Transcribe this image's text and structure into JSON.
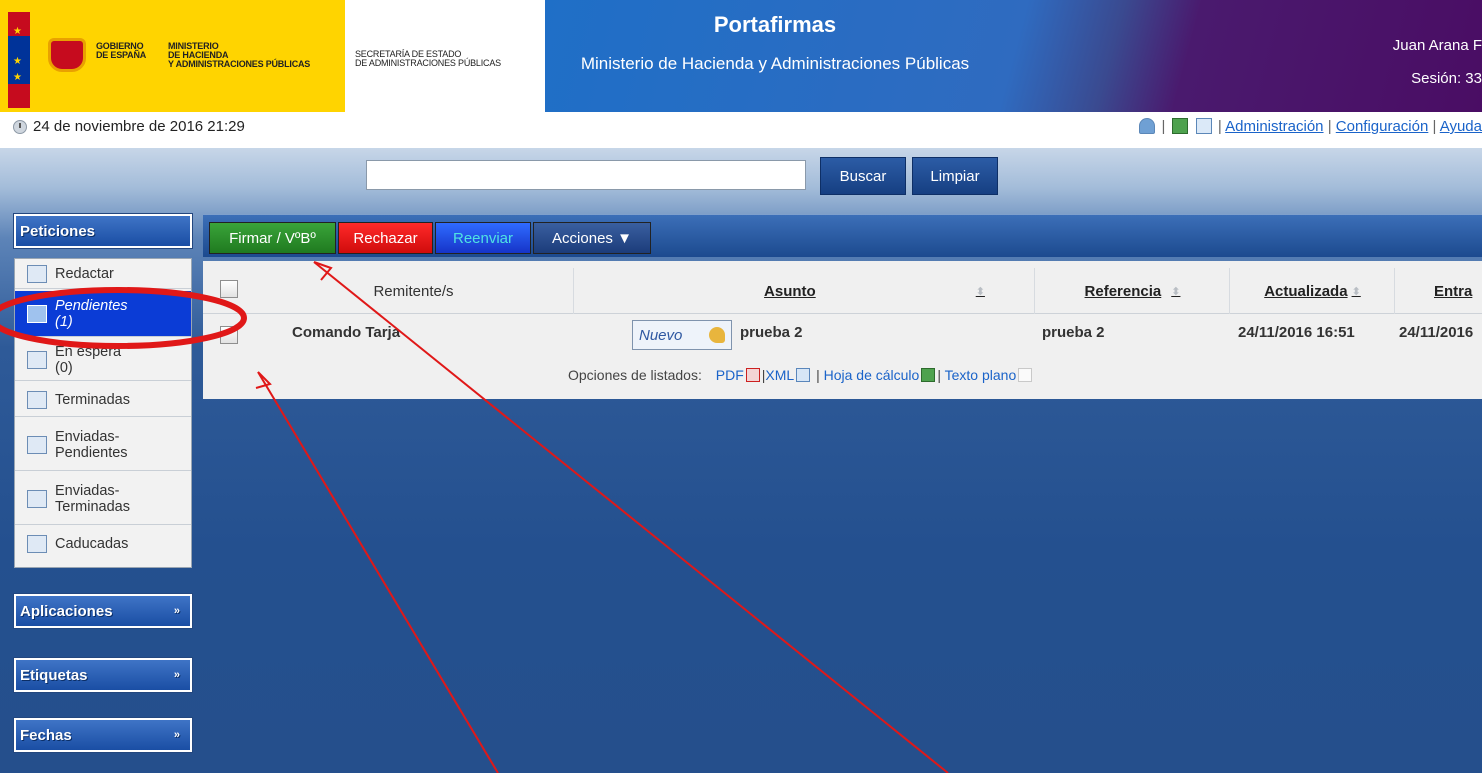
{
  "header": {
    "gov_line1": "GOBIERNO",
    "gov_line2": "DE ESPAÑA",
    "ministry_line1": "MINISTERIO",
    "ministry_line2": "DE HACIENDA",
    "ministry_line3": "Y ADMINISTRACIONES PÚBLICAS",
    "secretary_line1": "SECRETARÍA DE ESTADO",
    "secretary_line2": "DE ADMINISTRACIONES PÚBLICAS",
    "app_title": "Portafirmas",
    "ministry_title": "Ministerio de Hacienda y Administraciones Públicas",
    "user_name": "Juan Arana F",
    "session": "Sesión: 33"
  },
  "infobar": {
    "datetime": "24 de noviembre de 2016 21:29",
    "links": [
      "Administración",
      "Configuración",
      "Ayuda"
    ]
  },
  "search": {
    "value": "",
    "search_button": "Buscar",
    "clear_button": "Limpiar"
  },
  "sidebar": {
    "peticiones_title": "Peticiones",
    "items": [
      {
        "label": "Redactar",
        "icon": "compose-icon"
      },
      {
        "label": "Pendientes",
        "count": "(1)",
        "icon": "envelope-icon",
        "active": true
      },
      {
        "label": "En espera",
        "count": "(0)",
        "icon": "waiting-icon"
      },
      {
        "label": "Terminadas",
        "icon": "finished-icon"
      },
      {
        "label": "Enviadas-",
        "label2": "Pendientes",
        "icon": "sent-pending-icon"
      },
      {
        "label": "Enviadas-",
        "label2": "Terminadas",
        "icon": "sent-finished-icon"
      },
      {
        "label": "Caducadas",
        "icon": "expired-icon"
      }
    ],
    "aplicaciones": "Aplicaciones",
    "etiquetas": "Etiquetas",
    "fechas": "Fechas",
    "chevron": "»"
  },
  "toolbar": {
    "sign": "Firmar / VºBº",
    "reject": "Rechazar",
    "forward": "Reenviar",
    "actions": "Acciones ▼"
  },
  "table": {
    "columns": [
      "Remitente/s",
      "Asunto",
      "Referencia",
      "Actualizada",
      "Entra"
    ],
    "rows": [
      {
        "sender": "Comando Tarja",
        "badge": "Nuevo",
        "subject": "prueba 2",
        "reference": "prueba 2",
        "updated": "24/11/2016 16:51",
        "entered": "24/11/2016"
      }
    ]
  },
  "listing_options": {
    "label": "Opciones de listados:",
    "pdf": "PDF",
    "xml": "XML",
    "sheet": "Hoja de cálculo",
    "text": "Texto plano"
  },
  "colors": {
    "sign_green": "#2e8b2e",
    "reject_red": "#e01010",
    "forward_blue": "#1a3fd6",
    "annotation_red": "#e01818"
  }
}
